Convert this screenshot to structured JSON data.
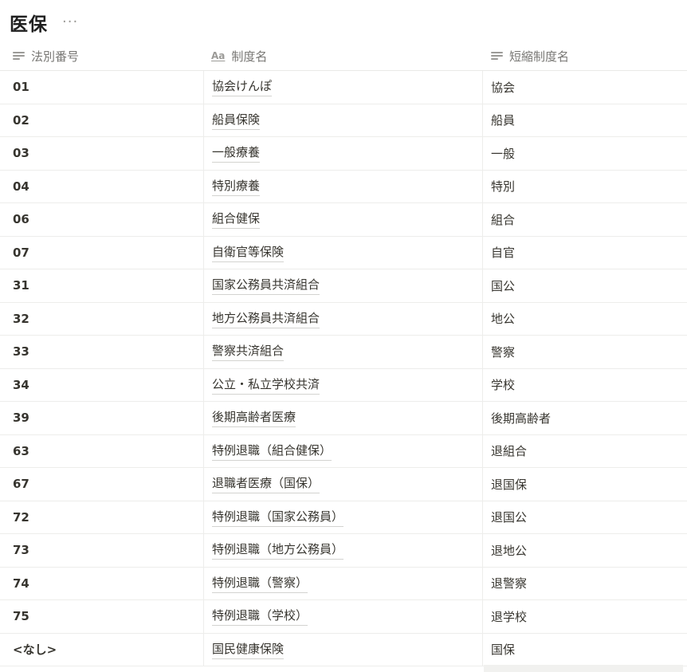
{
  "page": {
    "title": "医保",
    "more_label": "···"
  },
  "table": {
    "columns": [
      {
        "label": "法別番号",
        "icon": "text-lines-icon"
      },
      {
        "label": "制度名",
        "icon": "title-aa-icon",
        "icon_text": "Aa"
      },
      {
        "label": "短縮制度名",
        "icon": "text-lines-icon"
      }
    ],
    "rows": [
      {
        "code": "01",
        "name": "協会けんぽ",
        "short": "協会"
      },
      {
        "code": "02",
        "name": "船員保険",
        "short": "船員"
      },
      {
        "code": "03",
        "name": "一般療養",
        "short": "一般"
      },
      {
        "code": "04",
        "name": "特別療養",
        "short": "特別"
      },
      {
        "code": "06",
        "name": "組合健保",
        "short": "組合"
      },
      {
        "code": "07",
        "name": "自衛官等保険",
        "short": "自官"
      },
      {
        "code": "31",
        "name": "国家公務員共済組合",
        "short": "国公"
      },
      {
        "code": "32",
        "name": "地方公務員共済組合",
        "short": "地公"
      },
      {
        "code": "33",
        "name": "警察共済組合",
        "short": "警察"
      },
      {
        "code": "34",
        "name": "公立・私立学校共済",
        "short": "学校"
      },
      {
        "code": "39",
        "name": "後期高齢者医療",
        "short": "後期高齢者"
      },
      {
        "code": "63",
        "name": "特例退職（組合健保）",
        "short": "退組合"
      },
      {
        "code": "67",
        "name": "退職者医療（国保）",
        "short": "退国保"
      },
      {
        "code": "72",
        "name": "特例退職（国家公務員）",
        "short": "退国公"
      },
      {
        "code": "73",
        "name": "特例退職（地方公務員）",
        "short": "退地公"
      },
      {
        "code": "74",
        "name": "特例退職（警察）",
        "short": "退警察"
      },
      {
        "code": "75",
        "name": "特例退職（学校）",
        "short": "退学校"
      },
      {
        "code": "<なし>",
        "name": "国民健康保険",
        "short": "国保"
      }
    ]
  }
}
